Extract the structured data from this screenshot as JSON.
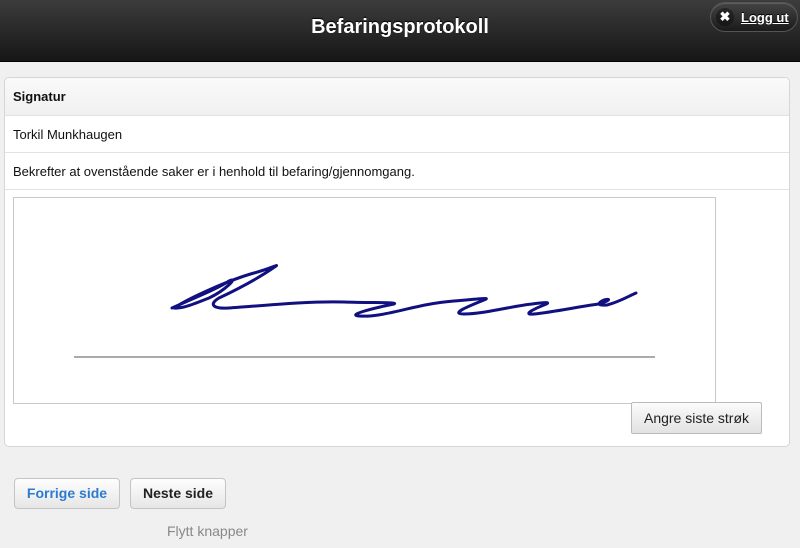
{
  "header": {
    "title": "Befaringsprotokoll",
    "logout_label": "Logg ut",
    "logout_icon_glyph": "✖"
  },
  "panel": {
    "heading": "Signatur",
    "name": "Torkil Munkhaugen",
    "confirmation": "Bekrefter at ovenstående saker er i henhold til befaring/gjennomgang.",
    "undo_label": "Angre siste strøk"
  },
  "signature": {
    "ink_color": "#101080",
    "baseline_color": "#aaaaaa"
  },
  "footer": {
    "prev_label": "Forrige side",
    "next_label": "Neste side",
    "move_label": "Flytt knapper"
  },
  "colors": {
    "link_blue": "#2b7bd0"
  }
}
